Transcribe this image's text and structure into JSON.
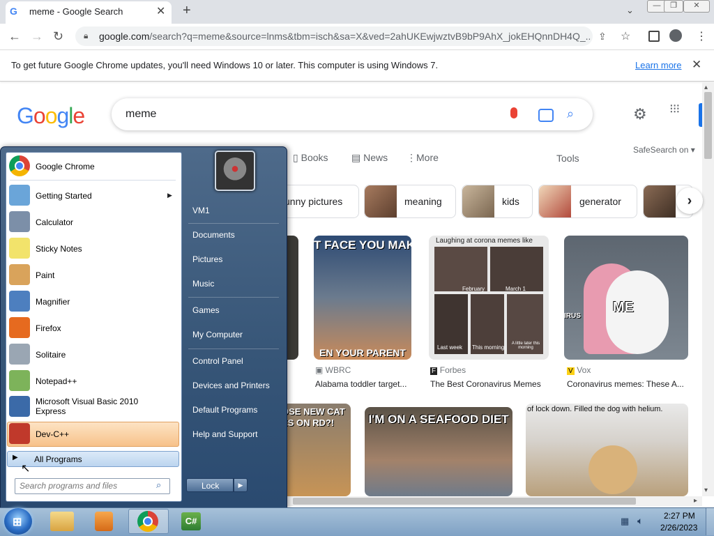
{
  "browser": {
    "tab_title": "meme - Google Search",
    "url_host": "google.com",
    "url_path": "/search?q=meme&source=lnms&tbm=isch&sa=X&ved=2ahUKEwjwztvB9bP9AhX_jokEHQnnDH4Q_...",
    "infobar_text": "To get future Google Chrome updates, you'll need Windows 10 or later. This computer is using Windows 7.",
    "infobar_link": "Learn more"
  },
  "google": {
    "query": "meme",
    "tabs": [
      "Books",
      "News",
      "More"
    ],
    "tools": "Tools",
    "safesearch": "SafeSearch on",
    "chips": [
      "unny pictures",
      "meaning",
      "kids",
      "generator"
    ],
    "results": [
      {
        "source": "WBRC",
        "title": "Alabama toddler target...",
        "overlay": "T FACE YOU MAK"
      },
      {
        "source": "Forbes",
        "title": "The Best Coronavirus Memes",
        "overlay": "Laughing at corona memes like"
      },
      {
        "source": "Vox",
        "title": "Coronavirus memes: These A...",
        "overlay": "ME"
      }
    ],
    "row2": [
      {
        "overlay": "OSE NEW CAT"
      },
      {
        "overlay": "I'M ON A SEAFOOD DIET"
      },
      {
        "overlay": "of lock down. Filled the dog with helium."
      }
    ],
    "thumb_text": {
      "cell_a": "February",
      "cell_b": "March 1",
      "cell_c": "Last week",
      "cell_d": "This morning",
      "cell_e": "A little later this morning",
      "vox_tag": "IRUS",
      "wbrc_bottom": "EN YOUR PARENT",
      "cat_line2": "ES ON RD?!"
    }
  },
  "startmenu": {
    "pinned": "Google Chrome",
    "programs": [
      {
        "label": "Getting Started",
        "color": "#6aa5d9"
      },
      {
        "label": "Calculator",
        "color": "#7c8fa8"
      },
      {
        "label": "Sticky Notes",
        "color": "#f2e36b"
      },
      {
        "label": "Paint",
        "color": "#d9a35b"
      },
      {
        "label": "Magnifier",
        "color": "#4d7fbf"
      },
      {
        "label": "Firefox",
        "color": "#e66a1f"
      },
      {
        "label": "Solitaire",
        "color": "#9aa6b3"
      },
      {
        "label": "Notepad++",
        "color": "#7db35a"
      },
      {
        "label": "Microsoft Visual Basic 2010 Express",
        "color": "#3b6aa8"
      },
      {
        "label": "Dev-C++",
        "color": "#c0392b"
      }
    ],
    "all_programs": "All Programs",
    "search_placeholder": "Search programs and files",
    "right_items": [
      "VM1",
      "Documents",
      "Pictures",
      "Music",
      "Games",
      "My Computer",
      "Control Panel",
      "Devices and Printers",
      "Default Programs",
      "Help and Support"
    ],
    "lock": "Lock"
  },
  "taskbar": {
    "time": "2:27 PM",
    "date": "2/26/2023"
  }
}
